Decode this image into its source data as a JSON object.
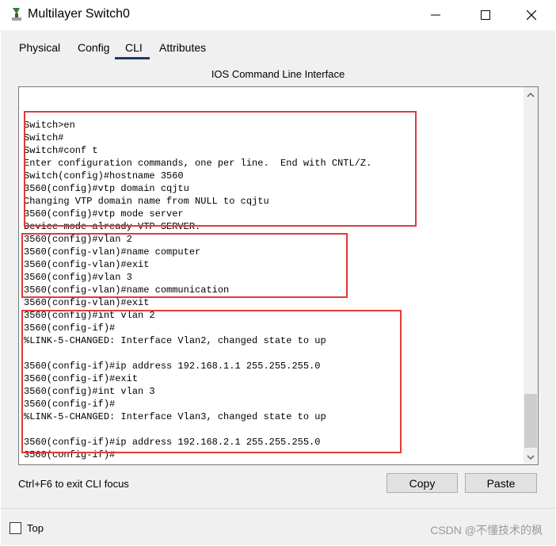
{
  "window": {
    "title": "Multilayer Switch0",
    "icon": "switch-icon"
  },
  "tabs": [
    {
      "label": "Physical",
      "active": false
    },
    {
      "label": "Config",
      "active": false
    },
    {
      "label": "CLI",
      "active": true
    },
    {
      "label": "Attributes",
      "active": false
    }
  ],
  "panel": {
    "header": "IOS Command Line Interface",
    "terminal_lines": [
      "Switch>en",
      "Switch#",
      "Switch#conf t",
      "Enter configuration commands, one per line.  End with CNTL/Z.",
      "Switch(config)#hostname 3560",
      "3560(config)#vtp domain cqjtu",
      "Changing VTP domain name from NULL to cqjtu",
      "3560(config)#vtp mode server",
      "Device mode already VTP SERVER.",
      "3560(config)#vlan 2",
      "3560(config-vlan)#name computer",
      "3560(config-vlan)#exit",
      "3560(config)#vlan 3",
      "3560(config-vlan)#name communication",
      "3560(config-vlan)#exit",
      "3560(config)#int vlan 2",
      "3560(config-if)#",
      "%LINK-5-CHANGED: Interface Vlan2, changed state to up",
      "",
      "3560(config-if)#ip address 192.168.1.1 255.255.255.0",
      "3560(config-if)#exit",
      "3560(config)#int vlan 3",
      "3560(config-if)#",
      "%LINK-5-CHANGED: Interface Vlan3, changed state to up",
      "",
      "3560(config-if)#ip address 192.168.2.1 255.255.255.0",
      "3560(config-if)#"
    ],
    "hint": "Ctrl+F6 to exit CLI focus",
    "copy_label": "Copy",
    "paste_label": "Paste"
  },
  "footer": {
    "top_label": "Top",
    "top_checked": false,
    "watermark": "CSDN @不懂技术的枫"
  },
  "colors": {
    "highlight": "#e03b3b",
    "active_tab_underline": "#1f3864"
  }
}
